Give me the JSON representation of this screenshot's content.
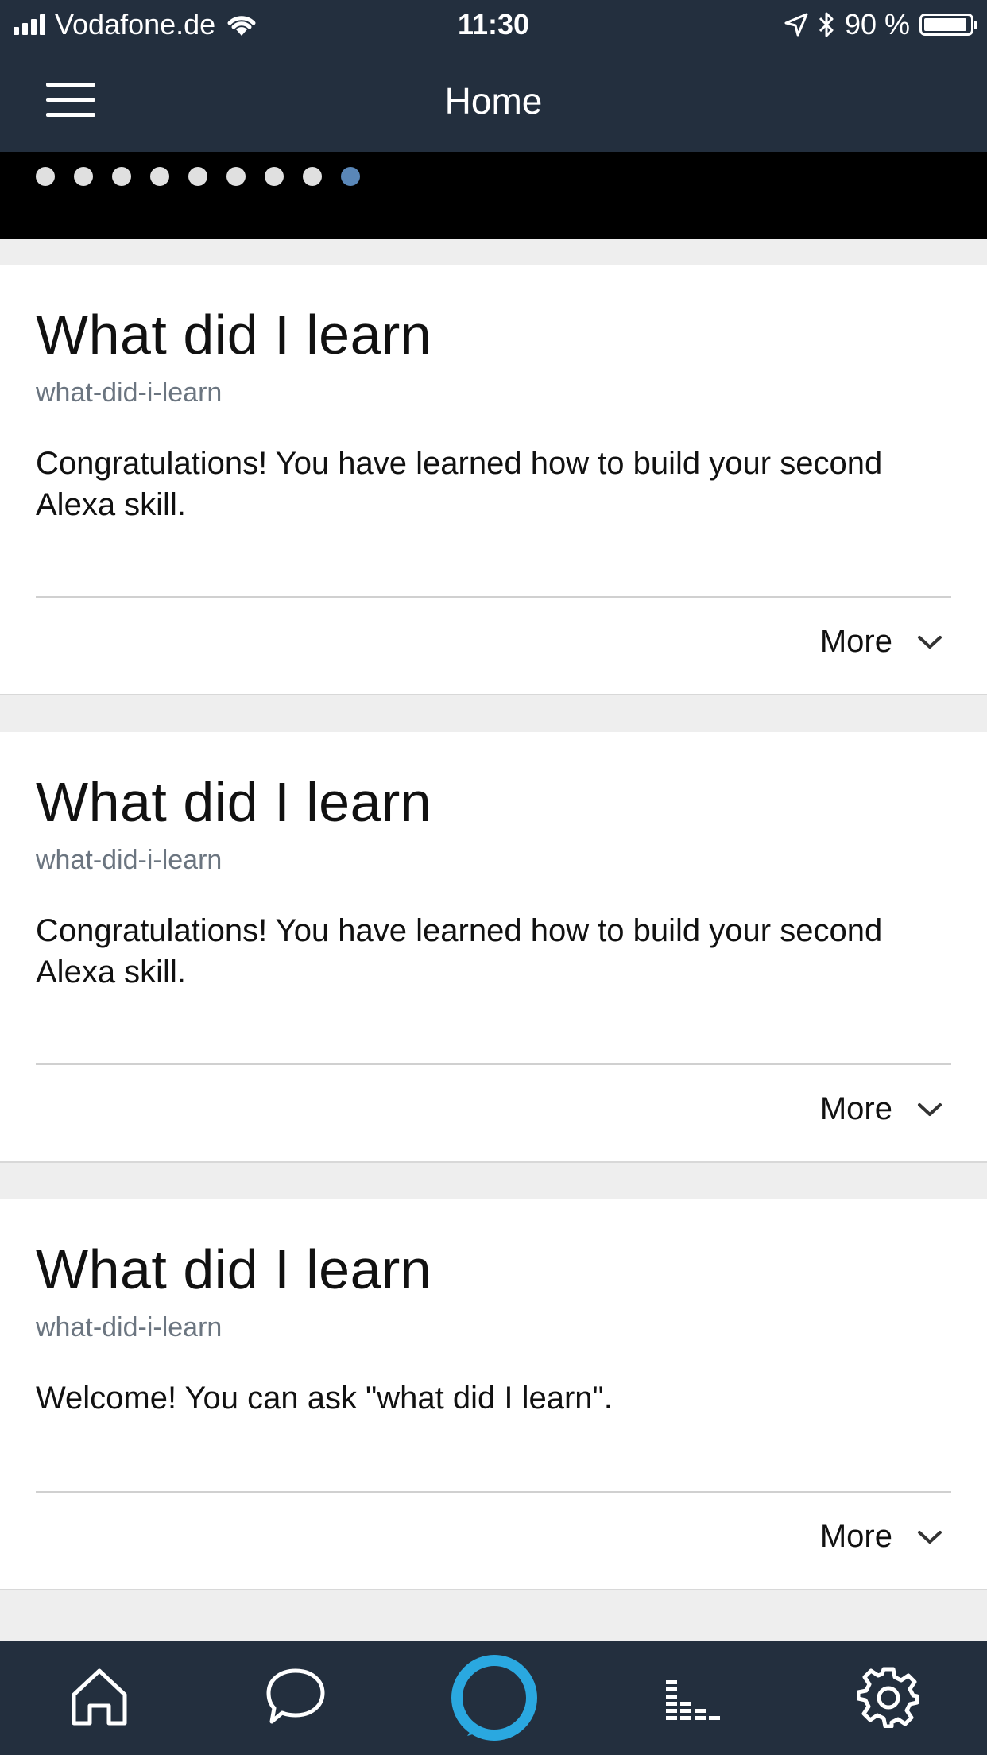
{
  "status": {
    "carrier": "Vodafone.de",
    "time": "11:30",
    "battery": "90 %"
  },
  "header": {
    "title": "Home"
  },
  "carousel": {
    "dot_count": 9,
    "active_index": 8
  },
  "cards": [
    {
      "title": "What did I learn",
      "subtitle": "what-did-i-learn",
      "body": "Congratulations! You have learned how to build your second Alexa skill.",
      "more_label": "More"
    },
    {
      "title": "What did I learn",
      "subtitle": "what-did-i-learn",
      "body": "Congratulations! You have learned how to build your second Alexa skill.",
      "more_label": "More"
    },
    {
      "title": "What did I learn",
      "subtitle": "what-did-i-learn",
      "body": "Welcome! You can ask \"what did I learn\".",
      "more_label": "More"
    }
  ],
  "tabbar": {
    "items": [
      "home-icon",
      "chat-icon",
      "alexa-icon",
      "music-icon",
      "settings-icon"
    ]
  },
  "colors": {
    "header_bg": "#232f3e",
    "active_dot": "#5a87b8",
    "alexa_ring": "#2aa8e0"
  }
}
